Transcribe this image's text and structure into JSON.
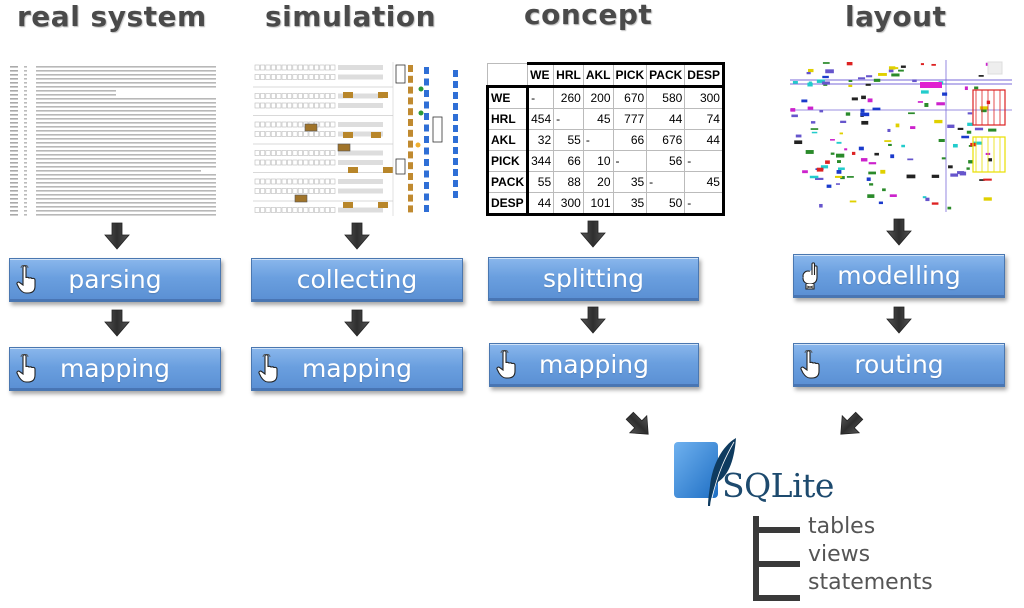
{
  "columns": [
    {
      "title": "real system",
      "source_image": "parsed-log-text-thumbnail",
      "steps": [
        {
          "label": "parsing",
          "icon": "hand-pointer-icon"
        },
        {
          "label": "mapping",
          "icon": "hand-pointer-icon"
        }
      ]
    },
    {
      "title": "simulation",
      "source_image": "warehouse-simulation-thumbnail",
      "steps": [
        {
          "label": "collecting",
          "icon": null
        },
        {
          "label": "mapping",
          "icon": "hand-pointer-icon"
        }
      ]
    },
    {
      "title": "concept",
      "source_image": "from-to-matrix",
      "steps": [
        {
          "label": "splitting",
          "icon": null
        },
        {
          "label": "mapping",
          "icon": "hand-pointer-icon"
        }
      ]
    },
    {
      "title": "layout",
      "source_image": "cad-layout-thumbnail",
      "steps": [
        {
          "label": "modelling",
          "icon": "hand-ok-icon"
        },
        {
          "label": "routing",
          "icon": "hand-pointer-icon"
        }
      ]
    }
  ],
  "matrix": {
    "headers": [
      "",
      "WE",
      "HRL",
      "AKL",
      "PICK",
      "PACK",
      "DESP"
    ],
    "rows": [
      {
        "label": "WE",
        "values": [
          "-",
          "260",
          "200",
          "670",
          "580",
          "300"
        ]
      },
      {
        "label": "HRL",
        "values": [
          "454",
          "-",
          "45",
          "777",
          "44",
          "74"
        ]
      },
      {
        "label": "AKL",
        "values": [
          "32",
          "55",
          "-",
          "66",
          "676",
          "44"
        ]
      },
      {
        "label": "PICK",
        "values": [
          "344",
          "66",
          "10",
          "-",
          "56",
          "-"
        ]
      },
      {
        "label": "PACK",
        "values": [
          "55",
          "88",
          "20",
          "35",
          "-",
          "45"
        ]
      },
      {
        "label": "DESP",
        "values": [
          "44",
          "300",
          "101",
          "35",
          "50",
          "-"
        ]
      }
    ]
  },
  "database": {
    "logo_text": "SQLite",
    "outputs": [
      "tables",
      "views",
      "statements"
    ]
  },
  "colors": {
    "step_box": "#6a9fdf",
    "title_text": "#4a4a4a",
    "arrow": "#3a3a3a",
    "sqlite_blue": "#2f7fd0",
    "sqlite_text": "#1d4a6e"
  }
}
